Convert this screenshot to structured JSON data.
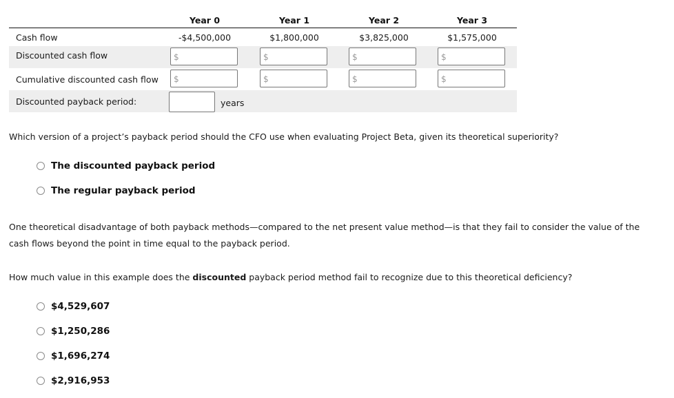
{
  "table": {
    "columns": [
      "Year 0",
      "Year 1",
      "Year 2",
      "Year 3"
    ],
    "rows": {
      "cash_flow": {
        "label": "Cash flow",
        "values": [
          "-$4,500,000",
          "$1,800,000",
          "$3,825,000",
          "$1,575,000"
        ]
      },
      "discounted_cash_flow": {
        "label": "Discounted cash flow",
        "prefix": "$",
        "values": [
          "",
          "",
          "",
          ""
        ]
      },
      "cumulative_discounted_cash_flow": {
        "label": "Cumulative discounted cash flow",
        "prefix": "$",
        "values": [
          "",
          "",
          "",
          ""
        ]
      },
      "discounted_payback_period": {
        "label": "Discounted payback period:",
        "value": "",
        "unit": "years"
      }
    }
  },
  "question1": {
    "text": "Which version of a project’s payback period should the CFO use when evaluating Project Beta, given its theoretical superiority?",
    "options": [
      "The discounted payback period",
      "The regular payback period"
    ]
  },
  "paragraph": {
    "text": "One theoretical disadvantage of both payback methods—compared to the net present value method—is that they fail to consider the value of the cash flows beyond the point in time equal to the payback period."
  },
  "question2": {
    "text_before": "How much value in this example does the ",
    "text_bold": "discounted",
    "text_after": " payback period method fail to recognize due to this theoretical deficiency?",
    "options": [
      "$4,529,607",
      "$1,250,286",
      "$1,696,274",
      "$2,916,953"
    ]
  }
}
